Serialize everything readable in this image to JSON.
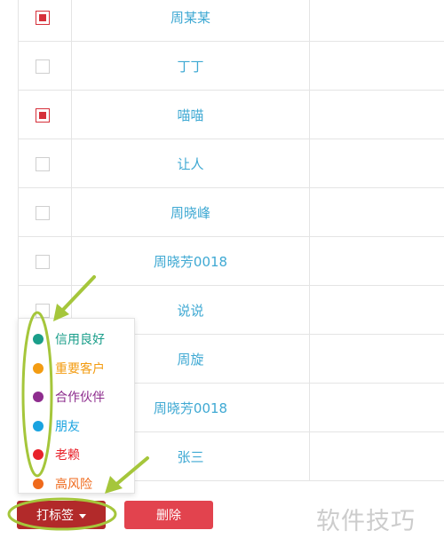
{
  "contacts": [
    {
      "name": "周某某",
      "checked": true
    },
    {
      "name": "丁丁",
      "checked": false
    },
    {
      "name": "喵喵",
      "checked": true
    },
    {
      "name": "让人",
      "checked": false
    },
    {
      "name": "周晓峰",
      "checked": false
    },
    {
      "name": "周晓芳0018",
      "checked": false
    },
    {
      "name": "说说",
      "checked": false
    },
    {
      "name": "周旋",
      "checked": false
    },
    {
      "name": "周晓芳0018",
      "checked": false
    },
    {
      "name": "张三",
      "checked": false
    }
  ],
  "tag_menu": [
    {
      "label": "信用良好",
      "color": "#1a9e8a"
    },
    {
      "label": "重要客户",
      "color": "#f39c12"
    },
    {
      "label": "合作伙伴",
      "color": "#8e2d8e"
    },
    {
      "label": "朋友",
      "color": "#1aa3e0"
    },
    {
      "label": "老赖",
      "color": "#e8222b"
    },
    {
      "label": "高风险",
      "color": "#ef6a1c"
    }
  ],
  "actions": {
    "tag_label": "打标签",
    "delete_label": "删除"
  },
  "colors": {
    "link": "#3fa9d3",
    "tag_button": "#b22a2a",
    "delete_button": "#e2434e",
    "annotation": "#a5c63b"
  },
  "watermark": "软件技巧"
}
